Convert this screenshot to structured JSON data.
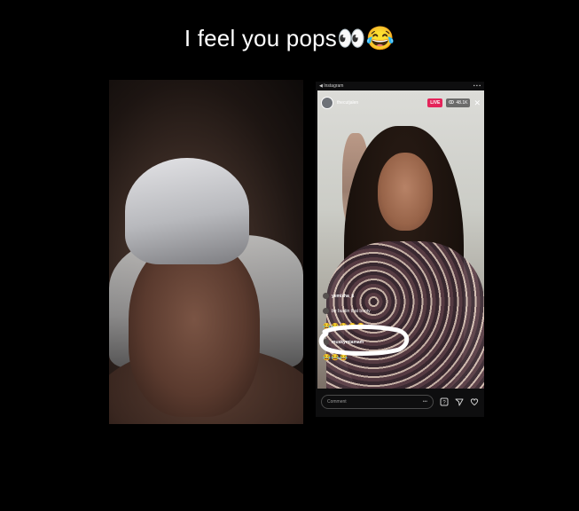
{
  "caption": {
    "text": "I feel you pops👀😂"
  },
  "live_stream": {
    "username": "thecutjalen",
    "live_label": "LIVE",
    "viewer_count": "48.1K",
    "status_bar": {
      "left": "◀ Instagram",
      "right": "▪ ▪ ▪"
    },
    "comments": [
      {
        "user": "yemizha_k",
        "text": ""
      },
      {
        "user": "",
        "text": "be bustin that booty"
      },
      {
        "user": "",
        "text": "😂😂😂😂😂"
      },
      {
        "user": "muskymiamam",
        "text": ""
      },
      {
        "user": "",
        "text": "😂😂😂"
      }
    ],
    "comment_placeholder": "Comment",
    "more_label": "•••"
  },
  "colors": {
    "live_badge": "#e4245a",
    "background": "#000000",
    "scribble": "#ffffff"
  },
  "icons": [
    "close-icon",
    "question-box-icon",
    "send-icon",
    "heart-icon",
    "eye-icon"
  ]
}
